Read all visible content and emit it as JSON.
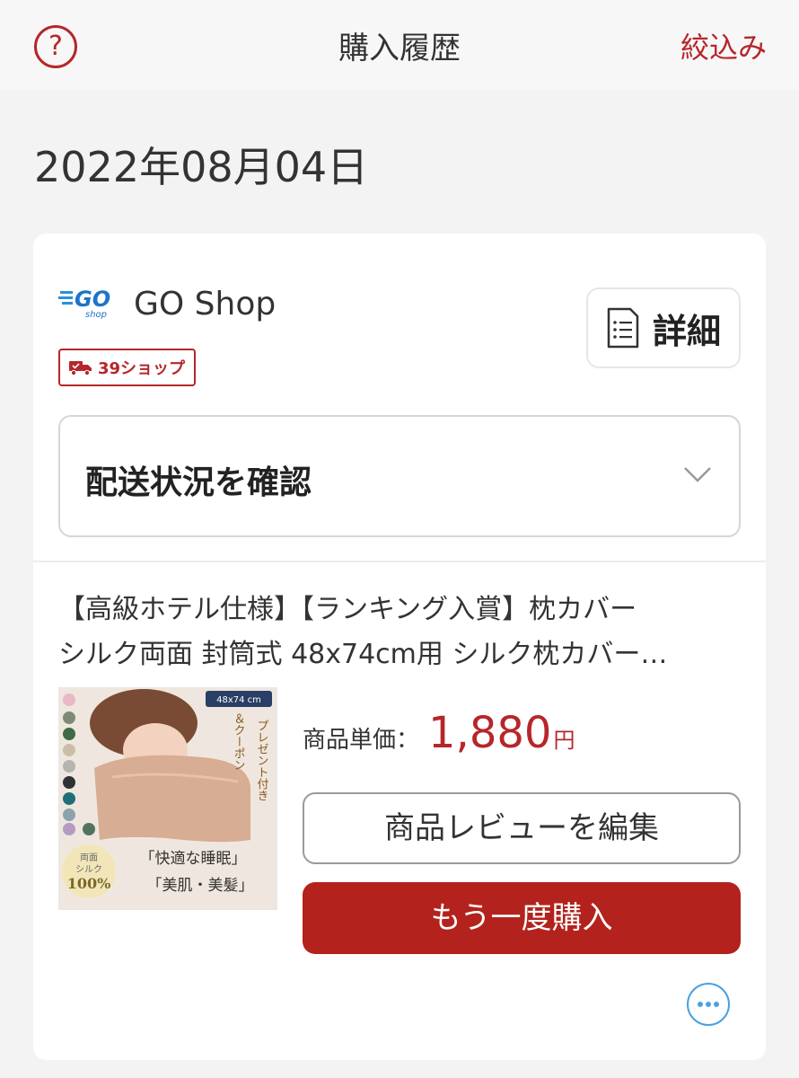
{
  "header": {
    "help_icon": "question-circle-icon",
    "help_glyph": "?",
    "title": "購入履歴",
    "filter_label": "絞込み"
  },
  "order": {
    "date": "2022年08月04日",
    "shop": {
      "logo_icon": "go-shop-logo",
      "logo_text": "GO",
      "logo_sub": "shop",
      "name": "GO Shop",
      "badge_icon": "delivery-truck-icon",
      "badge_label": "39ショップ"
    },
    "detail_button": {
      "icon": "document-list-icon",
      "label": "詳細"
    },
    "delivery_status": {
      "label": "配送状況を確認",
      "icon": "chevron-down-icon"
    },
    "product": {
      "title_line1": "【高級ホテル仕様】【ランキング入賞】枕カバー",
      "title_line2": "シルク両面 封筒式 48x74cm用 シルク枕カバー…",
      "image": {
        "size_label": "48x74 cm",
        "vertical_text_1": "プレゼント付き",
        "vertical_text_2": "＆クーポン",
        "circle_line1": "両面",
        "circle_line2": "シルク",
        "circle_line3": "100%",
        "caption1": "「快適な睡眠」",
        "caption2": "「美肌・美髪」"
      },
      "unit_price_label": "商品単価：",
      "unit_price": "1,880",
      "currency": "円"
    },
    "review_button_label": "商品レビューを編集",
    "buy_again_button_label": "もう一度購入",
    "more_icon": "more-horizontal-icon"
  },
  "colors": {
    "accent": "#b6262a",
    "buy_button": "#b3221c",
    "more_icon": "#4aa0e0",
    "background": "#f3f3f3"
  }
}
